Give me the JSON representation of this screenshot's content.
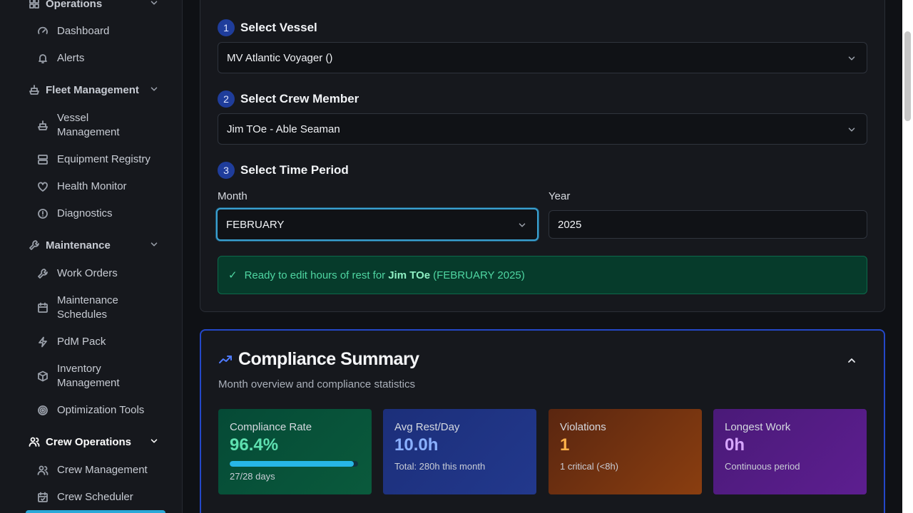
{
  "sidebar": {
    "sections": [
      {
        "label": "Operations",
        "icon": "grid-icon"
      },
      {
        "label": "Fleet Management",
        "icon": "ship-icon"
      },
      {
        "label": "Maintenance",
        "icon": "wrench-icon"
      },
      {
        "label": "Crew Operations",
        "icon": "users-icon"
      }
    ],
    "items": {
      "dashboard": "Dashboard",
      "alerts": "Alerts",
      "vessel_management": "Vessel Management",
      "equipment_registry": "Equipment Registry",
      "health_monitor": "Health Monitor",
      "diagnostics": "Diagnostics",
      "work_orders": "Work Orders",
      "maintenance_schedules": "Maintenance Schedules",
      "pdm_pack": "PdM Pack",
      "inventory_management": "Inventory Management",
      "optimization_tools": "Optimization Tools",
      "crew_management": "Crew Management",
      "crew_scheduler": "Crew Scheduler"
    }
  },
  "form": {
    "step1": {
      "num": "1",
      "title": "Select Vessel",
      "value": "MV Atlantic Voyager ()"
    },
    "step2": {
      "num": "2",
      "title": "Select Crew Member",
      "value": "Jim TOe - Able Seaman"
    },
    "step3": {
      "num": "3",
      "title": "Select Time Period"
    },
    "month_label": "Month",
    "month_value": "FEBRUARY",
    "year_label": "Year",
    "year_value": "2025",
    "ready": {
      "check": "✓",
      "prefix": "Ready to edit hours of rest for",
      "name": "Jim TOe",
      "suffix": "(FEBRUARY 2025)"
    }
  },
  "summary": {
    "title": "Compliance Summary",
    "subtitle": "Month overview and compliance statistics",
    "stats": [
      {
        "title": "Compliance Rate",
        "value": "96.4%",
        "sub": "27/28 days",
        "progress": 0.964
      },
      {
        "title": "Avg Rest/Day",
        "value": "10.0h",
        "sub": "Total: 280h this month"
      },
      {
        "title": "Violations",
        "value": "1",
        "sub": "1 critical (<8h)"
      },
      {
        "title": "Longest Work",
        "value": "0h",
        "sub": "Continuous period"
      }
    ]
  },
  "colors": {
    "accent": "#2448c8",
    "success": "#4fd6a2",
    "active_nav": "#2aa8d8"
  }
}
